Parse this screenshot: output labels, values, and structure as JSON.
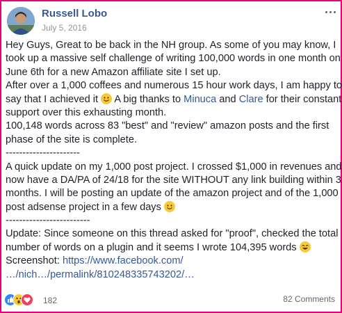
{
  "post": {
    "author": "Russell Lobo",
    "date": "July 5, 2016",
    "body": {
      "l1": "Hey Guys, Great to be back in the NH group. As some of you may know, I",
      "l2": "took up a massive self challenge of writing 100,000 words in one month on",
      "l3": "June 6th for a new Amazon affiliate site I set up.",
      "l4": "After over a 1,000 coffees and numerous 15 hour work days, I am happy to",
      "l5a": "say that I achieved it",
      "l5b": "A big thanks to",
      "mention1": "Minuca",
      "l5c": "and",
      "mention2": "Clare",
      "l5d": "for their constant",
      "l6": "support over this exhausting month.",
      "l7": "100,148 words across 83 \"best\" and \"review\" amazon posts and the first",
      "l8": "phase of the site is complete.",
      "sep1": "----------------------",
      "l9": "A quick update on my 1,000 post project. I crossed $1,000 in revenues and",
      "l10": "now have a DA/PA of 24/18 for the site WITHOUT any link building within 3",
      "l11": "months. I will be posting an update of the amazon project and of the 1,000",
      "l12": "post adsense project in a few days",
      "sep2": "-------------------------",
      "l13": "Update: Since someone on this thread asked for \"proof\", checked the total",
      "l14": "number of words on a plugin and it seems I wrote 104,395 words",
      "l15a": "Screenshot:",
      "link1": "https://www.facebook.com/",
      "link2": "…/nich…/permalink/810248335743202/…"
    },
    "emojis": [
      "smile-emoji",
      "smile-emoji",
      "laughing-emoji"
    ],
    "reactions": {
      "icons": [
        "like-icon",
        "wow-icon",
        "love-icon"
      ],
      "count": "182"
    },
    "comments": "82 Comments",
    "colors": {
      "link": "#365899",
      "border": "#e6007e",
      "text": "#1d2129",
      "meta": "#90949c"
    }
  }
}
